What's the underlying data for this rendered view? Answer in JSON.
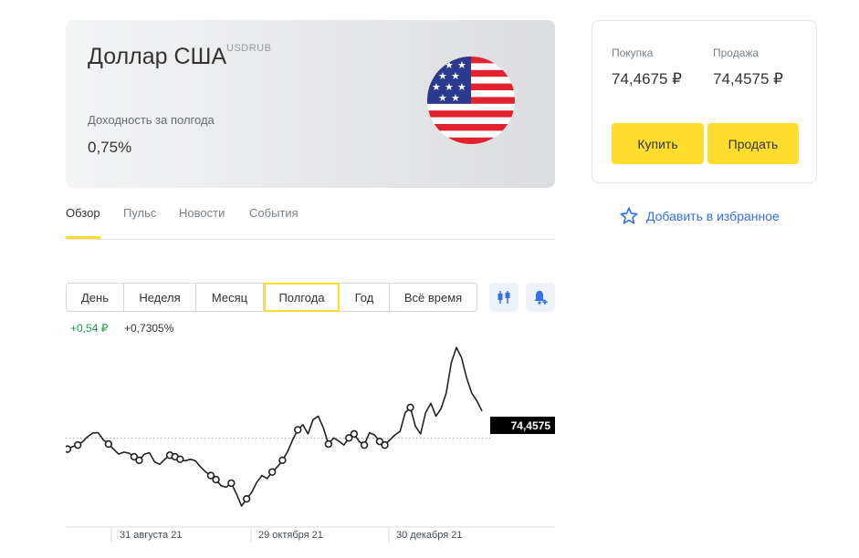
{
  "instrument": {
    "name": "Доллар США",
    "ticker": "USDRUB",
    "yield_label": "Доходность за полгода",
    "yield_value": "0,75%",
    "flag_icon": "us-flag-icon"
  },
  "tabs": [
    {
      "label": "Обзор",
      "active": true
    },
    {
      "label": "Пульс",
      "active": false
    },
    {
      "label": "Новости",
      "active": false
    },
    {
      "label": "События",
      "active": false
    }
  ],
  "ranges": [
    {
      "label": "День",
      "active": false
    },
    {
      "label": "Неделя",
      "active": false
    },
    {
      "label": "Месяц",
      "active": false
    },
    {
      "label": "Полгода",
      "active": true
    },
    {
      "label": "Год",
      "active": false
    },
    {
      "label": "Всё время",
      "active": false
    }
  ],
  "tools": {
    "candles_icon": "candlestick-icon",
    "alert_icon": "bell-plus-icon"
  },
  "change": {
    "absolute": "+0,54 ₽",
    "percent": "+0,7305%"
  },
  "trade": {
    "buy_label": "Покупка",
    "buy_price": "74,4675 ₽",
    "sell_label": "Продажа",
    "sell_price": "74,4575 ₽",
    "buy_button": "Купить",
    "sell_button": "Продать"
  },
  "favorite": {
    "label": "Добавить в избранное",
    "icon": "star-outline-icon"
  },
  "colors": {
    "accent_yellow": "#ffdd2d",
    "link_blue": "#336fee",
    "positive_green": "#13a04b"
  },
  "chart_data": {
    "type": "line",
    "x_ticks": [
      "31 августа 21",
      "29 октября 21",
      "30 декабря 21"
    ],
    "last_price_label": "74,4575",
    "baseline": 73.92,
    "y_range_estimate": [
      72.4,
      75.9
    ],
    "values": [
      73.7,
      73.75,
      73.78,
      73.85,
      73.95,
      74.02,
      74.02,
      73.88,
      73.8,
      73.7,
      73.6,
      73.64,
      73.62,
      73.55,
      73.48,
      73.6,
      73.63,
      73.45,
      73.4,
      73.5,
      73.58,
      73.55,
      73.5,
      73.47,
      73.5,
      73.47,
      73.35,
      73.25,
      73.18,
      73.1,
      72.98,
      72.95,
      73.03,
      72.82,
      72.58,
      72.72,
      72.85,
      73.05,
      73.18,
      73.12,
      73.25,
      73.35,
      73.48,
      73.65,
      73.88,
      74.08,
      74.18,
      74.0,
      74.28,
      74.35,
      74.12,
      73.8,
      73.92,
      73.86,
      73.78,
      73.92,
      74.0,
      73.85,
      73.78,
      74.02,
      73.98,
      73.85,
      73.78,
      73.88,
      73.98,
      74.05,
      74.42,
      74.52,
      74.15,
      74.0,
      74.42,
      74.6,
      74.35,
      74.5,
      74.8,
      75.4,
      75.7,
      75.5,
      75.1,
      74.8,
      74.65,
      74.45
    ],
    "markers": [
      0,
      2,
      8,
      13,
      14,
      20,
      21,
      22,
      28,
      29,
      32,
      35,
      40,
      42,
      45,
      51,
      55,
      56,
      58,
      61,
      62,
      67
    ],
    "grid": false
  }
}
